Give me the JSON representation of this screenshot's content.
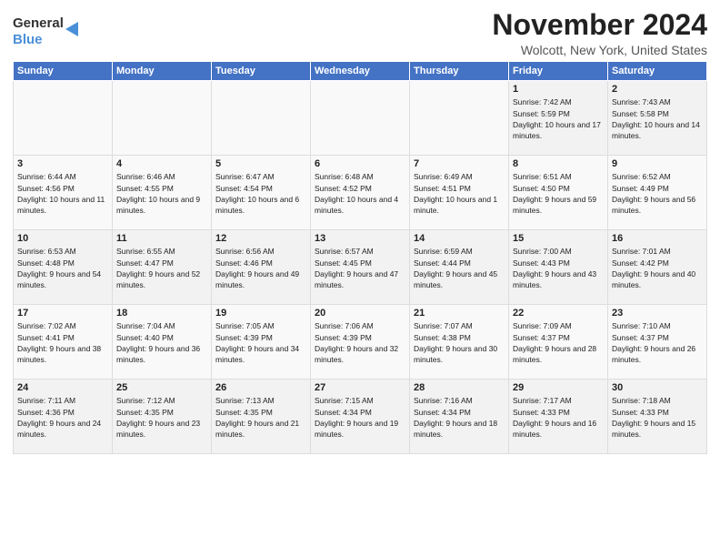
{
  "header": {
    "logo_general": "General",
    "logo_blue": "Blue",
    "month_title": "November 2024",
    "location": "Wolcott, New York, United States"
  },
  "weekdays": [
    "Sunday",
    "Monday",
    "Tuesday",
    "Wednesday",
    "Thursday",
    "Friday",
    "Saturday"
  ],
  "weeks": [
    [
      {
        "day": "",
        "info": ""
      },
      {
        "day": "",
        "info": ""
      },
      {
        "day": "",
        "info": ""
      },
      {
        "day": "",
        "info": ""
      },
      {
        "day": "",
        "info": ""
      },
      {
        "day": "1",
        "info": "Sunrise: 7:42 AM\nSunset: 5:59 PM\nDaylight: 10 hours and 17 minutes."
      },
      {
        "day": "2",
        "info": "Sunrise: 7:43 AM\nSunset: 5:58 PM\nDaylight: 10 hours and 14 minutes."
      }
    ],
    [
      {
        "day": "3",
        "info": "Sunrise: 6:44 AM\nSunset: 4:56 PM\nDaylight: 10 hours and 11 minutes."
      },
      {
        "day": "4",
        "info": "Sunrise: 6:46 AM\nSunset: 4:55 PM\nDaylight: 10 hours and 9 minutes."
      },
      {
        "day": "5",
        "info": "Sunrise: 6:47 AM\nSunset: 4:54 PM\nDaylight: 10 hours and 6 minutes."
      },
      {
        "day": "6",
        "info": "Sunrise: 6:48 AM\nSunset: 4:52 PM\nDaylight: 10 hours and 4 minutes."
      },
      {
        "day": "7",
        "info": "Sunrise: 6:49 AM\nSunset: 4:51 PM\nDaylight: 10 hours and 1 minute."
      },
      {
        "day": "8",
        "info": "Sunrise: 6:51 AM\nSunset: 4:50 PM\nDaylight: 9 hours and 59 minutes."
      },
      {
        "day": "9",
        "info": "Sunrise: 6:52 AM\nSunset: 4:49 PM\nDaylight: 9 hours and 56 minutes."
      }
    ],
    [
      {
        "day": "10",
        "info": "Sunrise: 6:53 AM\nSunset: 4:48 PM\nDaylight: 9 hours and 54 minutes."
      },
      {
        "day": "11",
        "info": "Sunrise: 6:55 AM\nSunset: 4:47 PM\nDaylight: 9 hours and 52 minutes."
      },
      {
        "day": "12",
        "info": "Sunrise: 6:56 AM\nSunset: 4:46 PM\nDaylight: 9 hours and 49 minutes."
      },
      {
        "day": "13",
        "info": "Sunrise: 6:57 AM\nSunset: 4:45 PM\nDaylight: 9 hours and 47 minutes."
      },
      {
        "day": "14",
        "info": "Sunrise: 6:59 AM\nSunset: 4:44 PM\nDaylight: 9 hours and 45 minutes."
      },
      {
        "day": "15",
        "info": "Sunrise: 7:00 AM\nSunset: 4:43 PM\nDaylight: 9 hours and 43 minutes."
      },
      {
        "day": "16",
        "info": "Sunrise: 7:01 AM\nSunset: 4:42 PM\nDaylight: 9 hours and 40 minutes."
      }
    ],
    [
      {
        "day": "17",
        "info": "Sunrise: 7:02 AM\nSunset: 4:41 PM\nDaylight: 9 hours and 38 minutes."
      },
      {
        "day": "18",
        "info": "Sunrise: 7:04 AM\nSunset: 4:40 PM\nDaylight: 9 hours and 36 minutes."
      },
      {
        "day": "19",
        "info": "Sunrise: 7:05 AM\nSunset: 4:39 PM\nDaylight: 9 hours and 34 minutes."
      },
      {
        "day": "20",
        "info": "Sunrise: 7:06 AM\nSunset: 4:39 PM\nDaylight: 9 hours and 32 minutes."
      },
      {
        "day": "21",
        "info": "Sunrise: 7:07 AM\nSunset: 4:38 PM\nDaylight: 9 hours and 30 minutes."
      },
      {
        "day": "22",
        "info": "Sunrise: 7:09 AM\nSunset: 4:37 PM\nDaylight: 9 hours and 28 minutes."
      },
      {
        "day": "23",
        "info": "Sunrise: 7:10 AM\nSunset: 4:37 PM\nDaylight: 9 hours and 26 minutes."
      }
    ],
    [
      {
        "day": "24",
        "info": "Sunrise: 7:11 AM\nSunset: 4:36 PM\nDaylight: 9 hours and 24 minutes."
      },
      {
        "day": "25",
        "info": "Sunrise: 7:12 AM\nSunset: 4:35 PM\nDaylight: 9 hours and 23 minutes."
      },
      {
        "day": "26",
        "info": "Sunrise: 7:13 AM\nSunset: 4:35 PM\nDaylight: 9 hours and 21 minutes."
      },
      {
        "day": "27",
        "info": "Sunrise: 7:15 AM\nSunset: 4:34 PM\nDaylight: 9 hours and 19 minutes."
      },
      {
        "day": "28",
        "info": "Sunrise: 7:16 AM\nSunset: 4:34 PM\nDaylight: 9 hours and 18 minutes."
      },
      {
        "day": "29",
        "info": "Sunrise: 7:17 AM\nSunset: 4:33 PM\nDaylight: 9 hours and 16 minutes."
      },
      {
        "day": "30",
        "info": "Sunrise: 7:18 AM\nSunset: 4:33 PM\nDaylight: 9 hours and 15 minutes."
      }
    ]
  ]
}
